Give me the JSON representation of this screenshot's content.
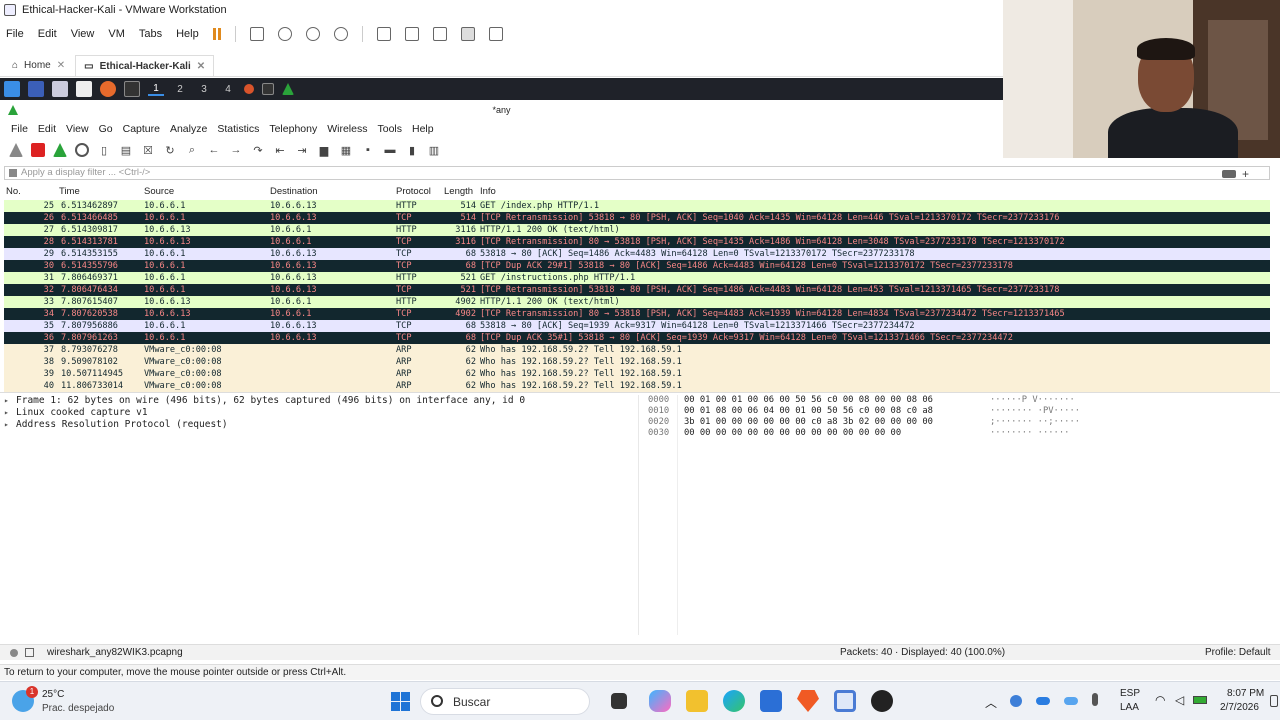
{
  "vm": {
    "title": "Ethical-Hacker-Kali - VMware Workstation",
    "menu": [
      "File",
      "Edit",
      "View",
      "VM",
      "Tabs",
      "Help"
    ],
    "tabs": [
      {
        "label": "Home",
        "active": false
      },
      {
        "label": "Ethical-Hacker-Kali",
        "active": true
      }
    ],
    "hint": "To return to your computer, move the mouse pointer outside or press Ctrl+Alt."
  },
  "kali_panel": {
    "workspaces": [
      "1",
      "2",
      "3",
      "4"
    ],
    "active_workspace": "1"
  },
  "wireshark": {
    "window_title": "*any",
    "menu": [
      "File",
      "Edit",
      "View",
      "Go",
      "Capture",
      "Analyze",
      "Statistics",
      "Telephony",
      "Wireless",
      "Tools",
      "Help"
    ],
    "filter_placeholder": "Apply a display filter ... <Ctrl-/>",
    "columns": {
      "no": "No.",
      "time": "Time",
      "source": "Source",
      "destination": "Destination",
      "protocol": "Protocol",
      "length": "Length",
      "info": "Info"
    },
    "packets": [
      {
        "no": "25",
        "time": "6.513462897",
        "src": "10.6.6.1",
        "dst": "10.6.6.13",
        "proto": "HTTP",
        "len": "514",
        "info": "GET /index.php HTTP/1.1",
        "style": "http"
      },
      {
        "no": "26",
        "time": "6.513466485",
        "src": "10.6.6.1",
        "dst": "10.6.6.13",
        "proto": "TCP",
        "len": "514",
        "info": "[TCP Retransmission] 53818 → 80 [PSH, ACK] Seq=1040 Ack=1435 Win=64128 Len=446 TSval=1213370172 TSecr=2377233176",
        "style": "bad"
      },
      {
        "no": "27",
        "time": "6.514309817",
        "src": "10.6.6.13",
        "dst": "10.6.6.1",
        "proto": "HTTP",
        "len": "3116",
        "info": "HTTP/1.1 200 OK  (text/html)",
        "style": "http"
      },
      {
        "no": "28",
        "time": "6.514313781",
        "src": "10.6.6.13",
        "dst": "10.6.6.1",
        "proto": "TCP",
        "len": "3116",
        "info": "[TCP Retransmission] 80 → 53818 [PSH, ACK] Seq=1435 Ack=1486 Win=64128 Len=3048 TSval=2377233178 TSecr=1213370172",
        "style": "bad"
      },
      {
        "no": "29",
        "time": "6.514353155",
        "src": "10.6.6.1",
        "dst": "10.6.6.13",
        "proto": "TCP",
        "len": "68",
        "info": "53818 → 80 [ACK] Seq=1486 Ack=4483 Win=64128 Len=0 TSval=1213370172 TSecr=2377233178",
        "style": "tcp"
      },
      {
        "no": "30",
        "time": "6.514355796",
        "src": "10.6.6.1",
        "dst": "10.6.6.13",
        "proto": "TCP",
        "len": "68",
        "info": "[TCP Dup ACK 29#1] 53818 → 80 [ACK] Seq=1486 Ack=4483 Win=64128 Len=0 TSval=1213370172 TSecr=2377233178",
        "style": "bad"
      },
      {
        "no": "31",
        "time": "7.806469371",
        "src": "10.6.6.1",
        "dst": "10.6.6.13",
        "proto": "HTTP",
        "len": "521",
        "info": "GET /instructions.php HTTP/1.1",
        "style": "http"
      },
      {
        "no": "32",
        "time": "7.806476434",
        "src": "10.6.6.1",
        "dst": "10.6.6.13",
        "proto": "TCP",
        "len": "521",
        "info": "[TCP Retransmission] 53818 → 80 [PSH, ACK] Seq=1486 Ack=4483 Win=64128 Len=453 TSval=1213371465 TSecr=2377233178",
        "style": "bad"
      },
      {
        "no": "33",
        "time": "7.807615407",
        "src": "10.6.6.13",
        "dst": "10.6.6.1",
        "proto": "HTTP",
        "len": "4902",
        "info": "HTTP/1.1 200 OK  (text/html)",
        "style": "http"
      },
      {
        "no": "34",
        "time": "7.807620538",
        "src": "10.6.6.13",
        "dst": "10.6.6.1",
        "proto": "TCP",
        "len": "4902",
        "info": "[TCP Retransmission] 80 → 53818 [PSH, ACK] Seq=4483 Ack=1939 Win=64128 Len=4834 TSval=2377234472 TSecr=1213371465",
        "style": "bad"
      },
      {
        "no": "35",
        "time": "7.807956886",
        "src": "10.6.6.1",
        "dst": "10.6.6.13",
        "proto": "TCP",
        "len": "68",
        "info": "53818 → 80 [ACK] Seq=1939 Ack=9317 Win=64128 Len=0 TSval=1213371466 TSecr=2377234472",
        "style": "tcp"
      },
      {
        "no": "36",
        "time": "7.807961263",
        "src": "10.6.6.1",
        "dst": "10.6.6.13",
        "proto": "TCP",
        "len": "68",
        "info": "[TCP Dup ACK 35#1] 53818 → 80 [ACK] Seq=1939 Ack=9317 Win=64128 Len=0 TSval=1213371466 TSecr=2377234472",
        "style": "bad"
      },
      {
        "no": "37",
        "time": "8.793076278",
        "src": "VMware_c0:00:08",
        "dst": "",
        "proto": "ARP",
        "len": "62",
        "info": "Who has 192.168.59.2? Tell 192.168.59.1",
        "style": "arp"
      },
      {
        "no": "38",
        "time": "9.509078102",
        "src": "VMware_c0:00:08",
        "dst": "",
        "proto": "ARP",
        "len": "62",
        "info": "Who has 192.168.59.2? Tell 192.168.59.1",
        "style": "arp"
      },
      {
        "no": "39",
        "time": "10.507114945",
        "src": "VMware_c0:00:08",
        "dst": "",
        "proto": "ARP",
        "len": "62",
        "info": "Who has 192.168.59.2? Tell 192.168.59.1",
        "style": "arp"
      },
      {
        "no": "40",
        "time": "11.806733014",
        "src": "VMware_c0:00:08",
        "dst": "",
        "proto": "ARP",
        "len": "62",
        "info": "Who has 192.168.59.2? Tell 192.168.59.1",
        "style": "arp"
      }
    ],
    "details": [
      "Frame 1: 62 bytes on wire (496 bits), 62 bytes captured (496 bits) on interface any, id 0",
      "Linux cooked capture v1",
      "Address Resolution Protocol (request)"
    ],
    "bytes": [
      {
        "offset": "0000",
        "hex": "00 01 00 01 00 06 00 50  56 c0 00 08 00 00 08 06",
        "ascii": "······P V·······"
      },
      {
        "offset": "0010",
        "hex": "00 01 08 00 06 04 00 01  00 50 56 c0 00 08 c0 a8",
        "ascii": "········ ·PV·····"
      },
      {
        "offset": "0020",
        "hex": "3b 01 00 00 00 00 00 00  c0 a8 3b 02 00 00 00 00",
        "ascii": ";······· ··;·····"
      },
      {
        "offset": "0030",
        "hex": "00 00 00 00 00 00 00 00  00 00 00 00 00 00",
        "ascii": "········ ······"
      }
    ],
    "status": {
      "file": "wireshark_any82WIK3.pcapng",
      "packets": "Packets: 40 · Displayed: 40 (100.0%)",
      "profile": "Profile: Default"
    }
  },
  "taskbar": {
    "weather_temp": "25°C",
    "weather_desc": "Prac. despejado",
    "weather_badge": "1",
    "search_placeholder": "Buscar",
    "lang1": "ESP",
    "lang2": "LAA",
    "time": "8:07 PM",
    "date": "2/7/2026"
  },
  "colors": {
    "http_row": "#e4ffc7",
    "tcp_row": "#e7e6ff",
    "bad_row_bg": "#12272e",
    "bad_row_fg": "#f78787",
    "arp_row": "#faf0d7"
  }
}
